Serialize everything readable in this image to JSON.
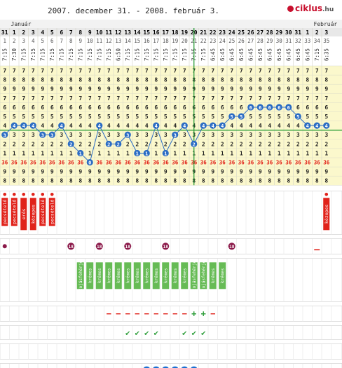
{
  "title": "2007. december 31. - 2008. február 3.",
  "logo": {
    "name": "ciklus",
    "suffix": ".hu"
  },
  "colors": {
    "grid_bg": "#fbf8cc",
    "grid_alt": "#ffffff",
    "temp_line": "#2b6cc4",
    "cover_line": "#2e9e3a",
    "ovulation_line": "#2e9e3a",
    "temp36": "#e0221a",
    "bleeding": "#e0221a",
    "mucus": "#66bb55",
    "intercourse": "#8b1a4a",
    "info": "#1a6fd1"
  },
  "chart_data": {
    "type": "line",
    "month_labels": [
      {
        "label": "Január",
        "start_index": 1
      },
      {
        "label": "Február",
        "start_index": 33
      }
    ],
    "days": [
      "31",
      "1",
      "2",
      "3",
      "4",
      "5",
      "6",
      "7",
      "8",
      "9",
      "10",
      "11",
      "12",
      "13",
      "14",
      "15",
      "16",
      "17",
      "18",
      "19",
      "20",
      "21",
      "22",
      "23",
      "24",
      "25",
      "26",
      "27",
      "28",
      "29",
      "30",
      "31",
      "1",
      "2",
      "3"
    ],
    "cycle_days": [
      "1",
      "2",
      "3",
      "4",
      "5",
      "6",
      "7",
      "8",
      "9",
      "10",
      "11",
      "12",
      "13",
      "14",
      "15",
      "16",
      "17",
      "18",
      "19",
      "20",
      "21",
      "22",
      "23",
      "24",
      "25",
      "26",
      "27",
      "28",
      "29",
      "30",
      "31",
      "32",
      "33",
      "34",
      "35"
    ],
    "times": [
      "7:15",
      "7:30",
      "7:15",
      "7:15",
      "7:15",
      "7:15",
      "7:15",
      "7:15",
      "7:15",
      "7:15",
      "7:15",
      "7:15",
      "6:50",
      "7:15",
      "7:15",
      "7:15",
      "7:15",
      "7:15",
      "7:15",
      "7:15",
      "7:15",
      "7:15",
      "6:45",
      "6:45",
      "6:45",
      "6:45",
      "6:45",
      "6:45",
      "6:45",
      "6:45",
      "6:45",
      "6:45",
      "6:45",
      "7:15",
      "6:35"
    ],
    "scale_rows": [
      "7",
      "8",
      "9",
      "7",
      "6",
      "5",
      "4",
      "3",
      "2",
      "1",
      "36",
      "9",
      "8"
    ],
    "temperature_digits": [
      3,
      4,
      4,
      4,
      3,
      3,
      4,
      2,
      1,
      0,
      4,
      2,
      2,
      3,
      1,
      1,
      4,
      1,
      3,
      4,
      2,
      4,
      4,
      4,
      5,
      5,
      6,
      6,
      6,
      6,
      6,
      5,
      4,
      4,
      4
    ],
    "temperature_unit_row": "36",
    "cover_line_digit": 3.5,
    "ovulation_day_index": 20,
    "bleeding": [
      {
        "index": 0,
        "label": "pecsételő"
      },
      {
        "index": 1,
        "label": "pecsételő"
      },
      {
        "index": 2,
        "label": "erős"
      },
      {
        "index": 3,
        "label": "közepes"
      },
      {
        "index": 4,
        "label": "pecsételő"
      },
      {
        "index": 5,
        "label": "pecsételő"
      },
      {
        "index": 34,
        "label": "közepes"
      }
    ],
    "intercourse_days": [
      7,
      10,
      13,
      17,
      24
    ],
    "intercourse_days_start": [
      0
    ],
    "mucus": [
      {
        "index": 8,
        "label": "tojásfehérje"
      },
      {
        "index": 9,
        "label": "krémes"
      },
      {
        "index": 10,
        "label": "krémes"
      },
      {
        "index": 11,
        "label": "krémes"
      },
      {
        "index": 12,
        "label": "krémes"
      },
      {
        "index": 13,
        "label": "krémes"
      },
      {
        "index": 14,
        "label": "krémes"
      },
      {
        "index": 15,
        "label": "krémes"
      },
      {
        "index": 16,
        "label": "krémes"
      },
      {
        "index": 17,
        "label": "krémes"
      },
      {
        "index": 18,
        "label": "krémes"
      },
      {
        "index": 19,
        "label": "krémes"
      },
      {
        "index": 20,
        "label": "tojásfehérje"
      },
      {
        "index": 21,
        "label": "tojásfehérje"
      },
      {
        "index": 22,
        "label": "krémes"
      },
      {
        "index": 23,
        "label": "krémes"
      }
    ],
    "dash_marks_upper": [
      33
    ],
    "test_results": [
      {
        "index": 11,
        "mark": "−"
      },
      {
        "index": 12,
        "mark": "−"
      },
      {
        "index": 13,
        "mark": "−"
      },
      {
        "index": 14,
        "mark": "−"
      },
      {
        "index": 15,
        "mark": "−"
      },
      {
        "index": 16,
        "mark": "−"
      },
      {
        "index": 17,
        "mark": "−"
      },
      {
        "index": 18,
        "mark": "−"
      },
      {
        "index": 19,
        "mark": "−"
      },
      {
        "index": 20,
        "mark": "+"
      },
      {
        "index": 21,
        "mark": "+"
      },
      {
        "index": 22,
        "mark": "−"
      }
    ],
    "checks": [
      13,
      14,
      15,
      16,
      19,
      20,
      21
    ],
    "info_marks": [
      15,
      16,
      17,
      18,
      19,
      20
    ]
  }
}
